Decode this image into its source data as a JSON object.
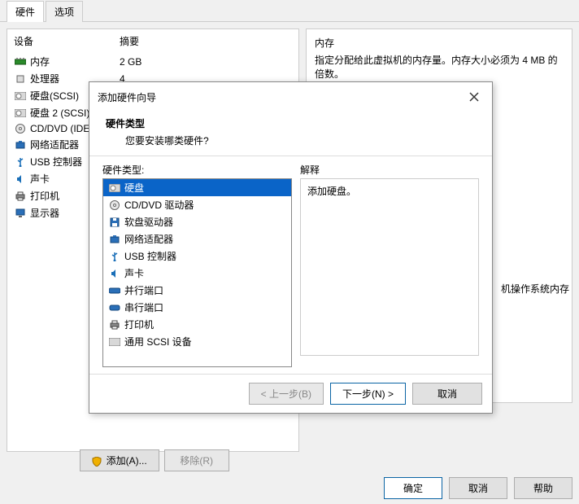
{
  "tabs": {
    "hardware": "硬件",
    "options": "选项"
  },
  "device_table": {
    "header_device": "设备",
    "header_summary": "摘要",
    "rows": [
      {
        "name": "内存",
        "summary": "2 GB"
      },
      {
        "name": "处理器",
        "summary": "4"
      },
      {
        "name": "硬盘(SCSI)",
        "summary": ""
      },
      {
        "name": "硬盘 2 (SCSI)",
        "summary": ""
      },
      {
        "name": "CD/DVD (IDE)",
        "summary": ""
      },
      {
        "name": "网络适配器",
        "summary": ""
      },
      {
        "name": "USB 控制器",
        "summary": ""
      },
      {
        "name": "声卡",
        "summary": ""
      },
      {
        "name": "打印机",
        "summary": ""
      },
      {
        "name": "显示器",
        "summary": ""
      }
    ]
  },
  "right_panel": {
    "title": "内存",
    "desc": "指定分配给此虚拟机的内存量。内存大小必须为 4 MB 的倍数。",
    "truncated_text": "机操作系统内存"
  },
  "bottom": {
    "add": "添加(A)...",
    "remove": "移除(R)"
  },
  "footer": {
    "ok": "确定",
    "cancel": "取消",
    "help": "帮助"
  },
  "wizard": {
    "window_title": "添加硬件向导",
    "heading": "硬件类型",
    "subheading": "您要安装哪类硬件?",
    "list_label": "硬件类型:",
    "explain_label": "解释",
    "explain_text": "添加硬盘。",
    "items": [
      {
        "label": "硬盘",
        "selected": true
      },
      {
        "label": "CD/DVD 驱动器"
      },
      {
        "label": "软盘驱动器"
      },
      {
        "label": "网络适配器"
      },
      {
        "label": "USB 控制器"
      },
      {
        "label": "声卡"
      },
      {
        "label": "并行端口"
      },
      {
        "label": "串行端口"
      },
      {
        "label": "打印机"
      },
      {
        "label": "通用 SCSI 设备"
      }
    ],
    "buttons": {
      "back": "< 上一步(B)",
      "next": "下一步(N) >",
      "cancel": "取消"
    }
  }
}
